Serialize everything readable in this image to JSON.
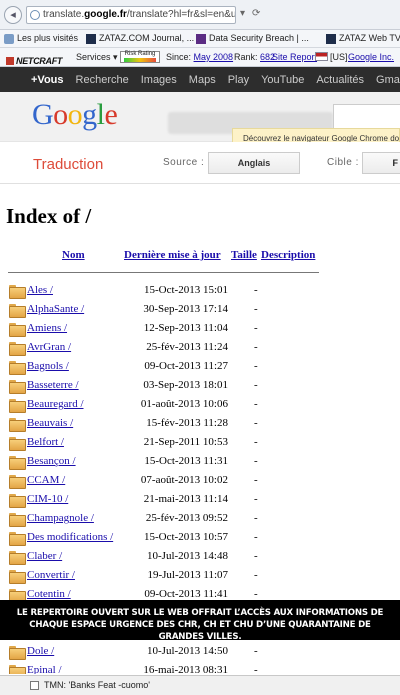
{
  "browser": {
    "url_prefix": "translate.",
    "url_host": "google.fr",
    "url_path": "/translate?hl=fr&sl=en&u=",
    "bookmarks": [
      {
        "label": "Les plus visités"
      },
      {
        "label": "ZATAZ.COM Journal, ..."
      },
      {
        "label": "Data Security Breach | ..."
      },
      {
        "label": "ZATAZ Web TV"
      }
    ],
    "netcraft": {
      "logo": "NETCRAFT",
      "services": "Services",
      "risk_label": "Risk Rating",
      "since_label": "Since:",
      "since_value": "May 2008",
      "rank_label": "Rank:",
      "rank_value": "682",
      "site_report": "Site Report",
      "country": "[US]",
      "host": "Google Inc."
    }
  },
  "google_bar": [
    "+Vous",
    "Recherche",
    "Images",
    "Maps",
    "Play",
    "YouTube",
    "Actualités",
    "Gmail"
  ],
  "google": {
    "logo_letters": [
      {
        "ch": "G",
        "color": "#3366cc"
      },
      {
        "ch": "o",
        "color": "#d73a2b"
      },
      {
        "ch": "o",
        "color": "#f2b50f"
      },
      {
        "ch": "g",
        "color": "#3366cc"
      },
      {
        "ch": "l",
        "color": "#2a9d3f"
      },
      {
        "ch": "e",
        "color": "#d73a2b"
      }
    ],
    "promo": "Découvrez le navigateur Google Chrome doté"
  },
  "translate": {
    "title": "Traduction",
    "source_label": "Source :",
    "source_value": "Anglais",
    "target_label": "Cible :",
    "target_value": "F"
  },
  "index": {
    "heading": "Index of /",
    "columns": {
      "name": "Nom",
      "date": "Dernière mise à jour",
      "size": "Taille",
      "desc": "Description"
    },
    "rows": [
      {
        "name": "Ales /",
        "date": "15-Oct-2013 15:01",
        "size": "-"
      },
      {
        "name": "AlphaSante /",
        "date": "30-Sep-2013 17:14",
        "size": "-"
      },
      {
        "name": "Amiens /",
        "date": "12-Sep-2013 11:04",
        "size": "-"
      },
      {
        "name": "AvrGran /",
        "date": "25-fév-2013 11:24",
        "size": "-"
      },
      {
        "name": "Bagnols /",
        "date": "09-Oct-2013 11:27",
        "size": "-"
      },
      {
        "name": "Basseterre /",
        "date": "03-Sep-2013 18:01",
        "size": "-"
      },
      {
        "name": "Beauregard /",
        "date": "01-août-2013 10:06",
        "size": "-"
      },
      {
        "name": "Beauvais /",
        "date": "15-fév-2013 11:28",
        "size": "-"
      },
      {
        "name": "Belfort /",
        "date": "21-Sep-2011 10:53",
        "size": "-"
      },
      {
        "name": "Besançon /",
        "date": "15-Oct-2013 11:31",
        "size": "-"
      },
      {
        "name": "CCAM /",
        "date": "07-août-2013 10:02",
        "size": "-"
      },
      {
        "name": "CIM-10 /",
        "date": "21-mai-2013 11:14",
        "size": "-"
      },
      {
        "name": "Champagnole /",
        "date": "25-fév-2013 09:52",
        "size": "-"
      },
      {
        "name": "Des modifications /",
        "date": "15-Oct-2013 10:57",
        "size": "-"
      },
      {
        "name": "Claber /",
        "date": "10-Jul-2013 14:48",
        "size": "-"
      },
      {
        "name": "Convertir /",
        "date": "19-Jul-2013 11:07",
        "size": "-"
      },
      {
        "name": "Cotentin /",
        "date": "09-Oct-2013 11:41",
        "size": "-"
      },
      {
        "name": "",
        "date": "",
        "size": ""
      },
      {
        "name": "",
        "date": "",
        "size": ""
      },
      {
        "name": "Dole /",
        "date": "10-Jul-2013 14:50",
        "size": "-"
      },
      {
        "name": "Epinal /",
        "date": "16-mai-2013 08:31",
        "size": "-"
      }
    ]
  },
  "caption": "LE REPERTOIRE OUVERT SUR LE WEB OFFRAIT L’ACCÈS AUX INFORMATIONS DE CHAQUE ESPACE URGENCE DES CHR, CH ET CHU D’UNE QUARANTAINE DE GRANDES VILLES.",
  "status": "TMN: 'Banks Feat -cuomo'"
}
